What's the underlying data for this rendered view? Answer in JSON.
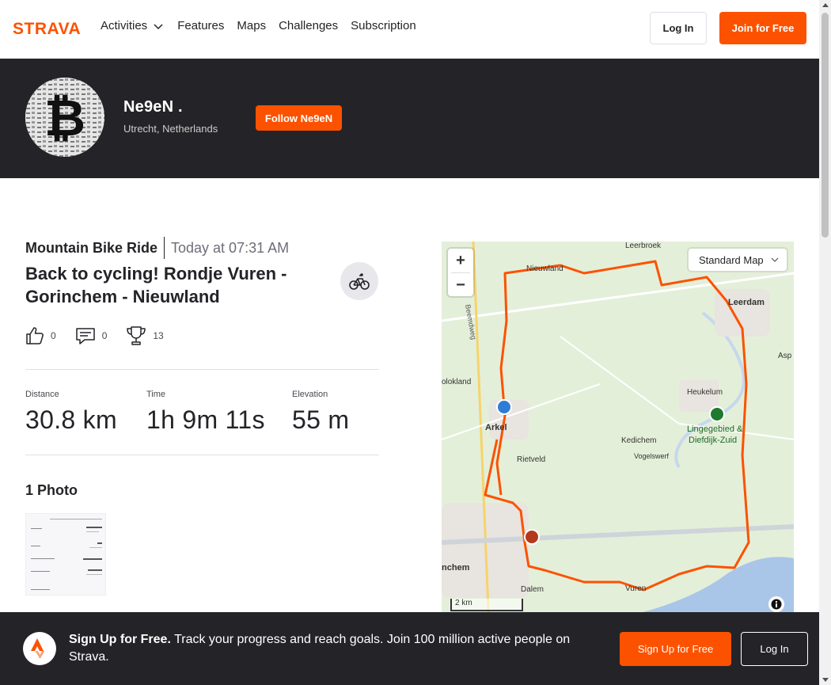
{
  "nav": {
    "logo_text": "STRAVA",
    "items": [
      {
        "label": "Activities",
        "has_dropdown": true
      },
      {
        "label": "Features"
      },
      {
        "label": "Maps"
      },
      {
        "label": "Challenges"
      },
      {
        "label": "Subscription"
      }
    ],
    "login_label": "Log In",
    "join_label": "Join for Free"
  },
  "athlete": {
    "name": "Ne9eN .",
    "location": "Utrecht, Netherlands",
    "follow_label": "Follow Ne9eN"
  },
  "activity": {
    "type": "Mountain Bike Ride",
    "date": "Today at 07:31 AM",
    "title": "Back to cycling! Rondje Vuren - Gorinchem - Nieuwland",
    "kudos": "0",
    "comments": "0",
    "achievements": "13",
    "stats": [
      {
        "label": "Distance",
        "value": "30.8 km"
      },
      {
        "label": "Time",
        "value": "1h 9m 11s"
      },
      {
        "label": "Elevation",
        "value": "55 m"
      }
    ],
    "photos_title": "1 Photo"
  },
  "map": {
    "style_label": "Standard Map",
    "zoom_in": "+",
    "zoom_out": "−",
    "scale_label": "2 km",
    "place_labels": [
      "Leerbroek",
      "Nieuwland",
      "Leerdam",
      "Asp",
      "Beemdweg",
      "olokland",
      "Heukelum",
      "Lingegebied & Diefdijk-Zuid",
      "Arkel",
      "Kedichem",
      "Rietveld",
      "Vogelswerf",
      "nchem",
      "Dalem",
      "Vuren"
    ],
    "route_color": "#fc5200"
  },
  "banner": {
    "bold_text": "Sign Up for Free.",
    "text": " Track your progress and reach goals. Join 100 million active people on Strava.",
    "signup_label": "Sign Up for Free",
    "login_label": "Log In"
  },
  "colors": {
    "brand": "#fc5200",
    "dark": "#242428"
  }
}
